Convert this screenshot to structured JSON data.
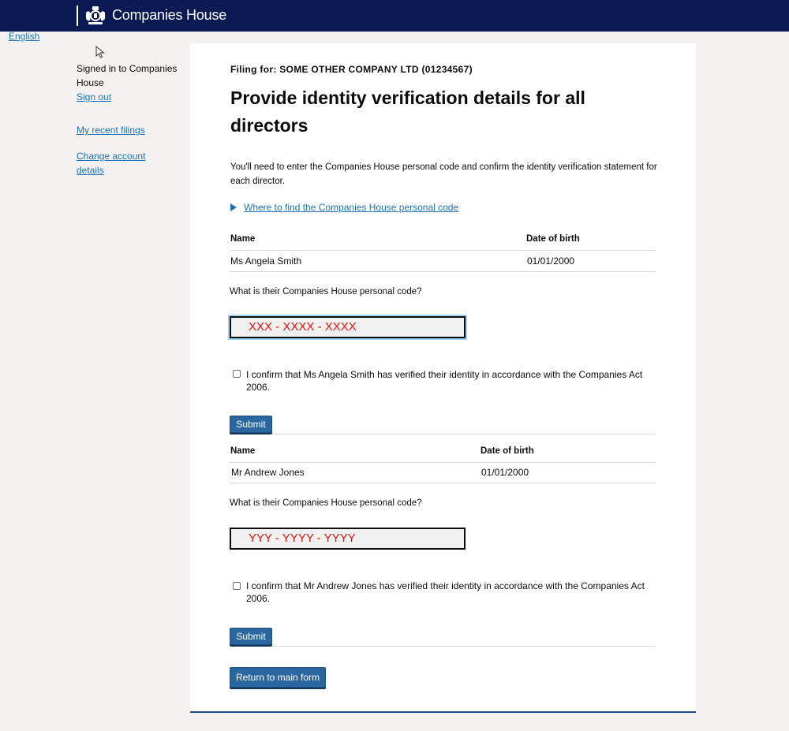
{
  "header": {
    "brand": "Companies House"
  },
  "language": {
    "label": "English"
  },
  "sidebar": {
    "signed_in": "Signed in to Companies House",
    "sign_out": "Sign out",
    "recent_filings": "My recent filings",
    "change_account": "Change account details"
  },
  "main": {
    "filing_for": "Filing for: SOME OTHER COMPANY LTD (01234567)",
    "title": "Provide identity verification details for all directors",
    "intro": "You'll need to enter the Companies House personal code and confirm the identity verification statement for each director.",
    "details_link": "Where to find the Companies House personal code",
    "table_headers": {
      "name": "Name",
      "dob": "Date of birth"
    },
    "question": "What is their Companies House personal code?",
    "directors": [
      {
        "name": "Ms Angela Smith",
        "dob": "01/01/2000",
        "code": "XXX - XXXX - XXXX",
        "confirm": "I confirm that Ms Angela Smith has verified their identity in accordance with the Companies Act 2006.",
        "checked": false,
        "submit": "Submit"
      },
      {
        "name": "Mr Andrew Jones",
        "dob": "01/01/2000",
        "code": "YYY - YYYY - YYYY",
        "confirm": "I confirm that Mr Andrew Jones has verified their identity in accordance with the Companies Act 2006.",
        "checked": false,
        "submit": "Submit"
      }
    ],
    "return_button": "Return to main form"
  },
  "colors": {
    "header": "#0b1a55",
    "link": "#1d70b8",
    "button": "#2a67a1",
    "code_text": "#e8120c"
  }
}
